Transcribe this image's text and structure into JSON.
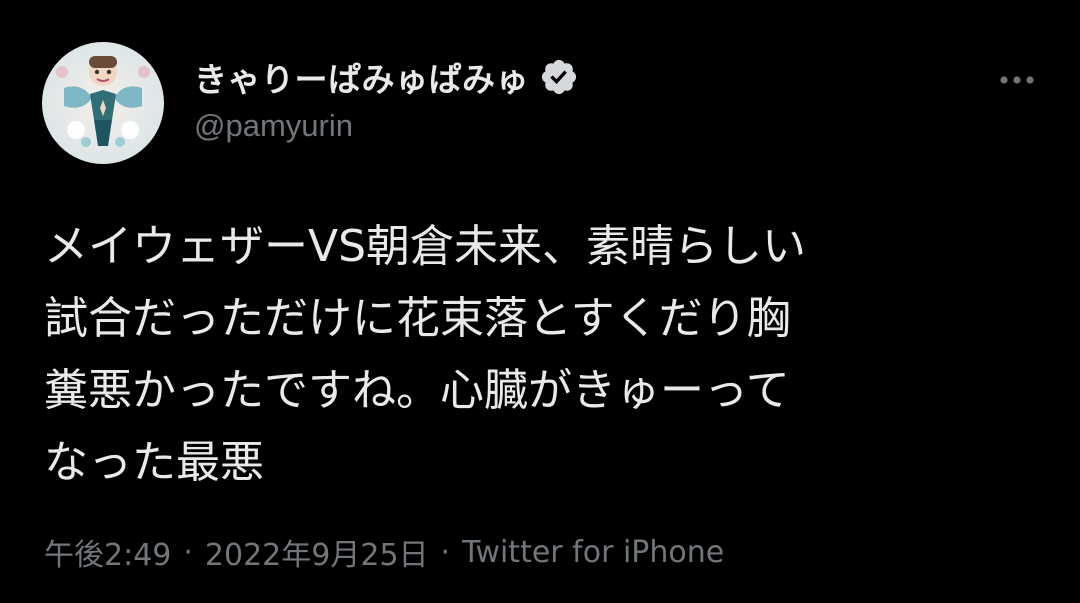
{
  "author": {
    "display_name": "きゃりーぱみゅぱみゅ",
    "handle": "@pamyurin",
    "verified_icon": "verified-badge-icon",
    "more_icon": "more-options-icon"
  },
  "tweet": {
    "lines": [
      "メイウェザーVS朝倉未来、素晴らしい",
      "試合だっただけに花束落とすくだり胸",
      "糞悪かったですね。心臓がきゅーって",
      "なった最悪"
    ]
  },
  "meta": {
    "time": "午後2:49",
    "separator": "·",
    "date": "2022年9月25日",
    "source": "Twitter for iPhone"
  },
  "colors": {
    "background": "#000000",
    "primary_text": "#e7e9ea",
    "secondary_text": "#71767b"
  }
}
